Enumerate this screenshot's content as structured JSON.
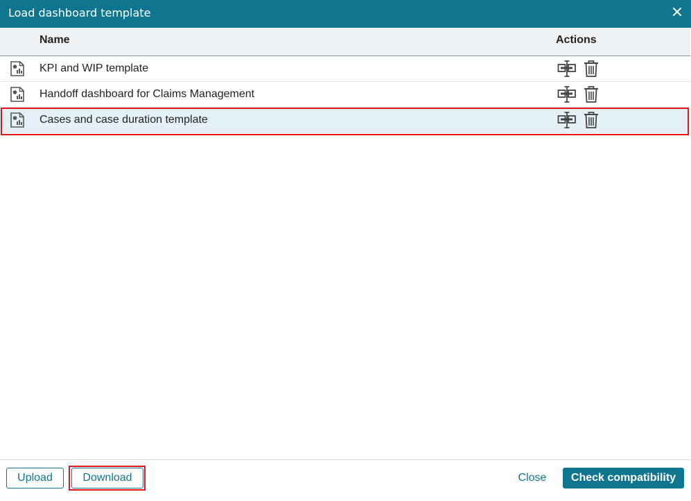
{
  "dialog": {
    "title": "Load dashboard template",
    "close_icon": "close-icon"
  },
  "table": {
    "columns": {
      "name": "Name",
      "actions": "Actions"
    },
    "rows": [
      {
        "name": "KPI and WIP template",
        "selected": false
      },
      {
        "name": "Handoff dashboard for Claims Management",
        "selected": false
      },
      {
        "name": "Cases and case duration template",
        "selected": true
      }
    ],
    "row_icon": "dashboard-document-icon",
    "action_icons": [
      "check-compatibility-icon",
      "trash-icon"
    ]
  },
  "footer": {
    "upload_label": "Upload",
    "download_label": "Download",
    "close_label": "Close",
    "check_label": "Check compatibility"
  },
  "colors": {
    "titlebar": "#10768f",
    "accent": "#10768f",
    "selected_row": "#e3f1f6",
    "highlight": "#e3141b"
  }
}
